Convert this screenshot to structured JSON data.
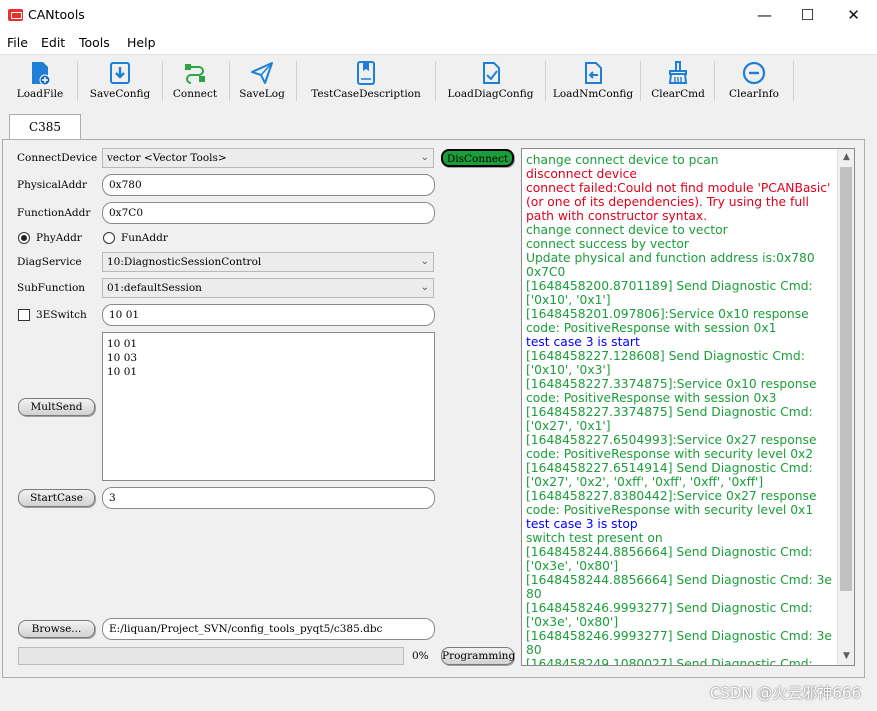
{
  "window": {
    "title": "CANtools",
    "minimize": "—",
    "maximize": "☐",
    "close": "✕"
  },
  "menu": {
    "items": [
      "File",
      "Edit",
      "Tools",
      "Help"
    ]
  },
  "toolbar": {
    "buttons": [
      {
        "label": "LoadFile",
        "icon": "file-load-icon"
      },
      {
        "label": "SaveConfig",
        "icon": "download-save-icon"
      },
      {
        "label": "Connect",
        "icon": "connect-icon"
      },
      {
        "label": "SaveLog",
        "icon": "paper-plane-icon"
      },
      {
        "label": "TestCaseDescription",
        "icon": "book-icon"
      },
      {
        "label": "LoadDiagConfig",
        "icon": "diag-config-icon"
      },
      {
        "label": "LoadNmConfig",
        "icon": "nm-config-icon"
      },
      {
        "label": "ClearCmd",
        "icon": "broom-icon"
      },
      {
        "label": "ClearInfo",
        "icon": "minus-circle-icon"
      }
    ]
  },
  "tab": {
    "label": "C385"
  },
  "form": {
    "connect_device_label": "ConnectDevice",
    "connect_device_value": "vector <Vector Tools>",
    "physical_addr_label": "PhysicalAddr",
    "physical_addr_value": "0x780",
    "function_addr_label": "FunctionAddr",
    "function_addr_value": "0x7C0",
    "phy_addr_label": "PhyAddr",
    "fun_addr_label": "FunAddr",
    "diag_service_label": "DiagService",
    "diag_service_value": "10:DiagnosticSessionControl",
    "sub_function_label": "SubFunction",
    "sub_function_value": "01:defaultSession",
    "switch_3e_label": "3ESwitch",
    "switch_3e_value": "10 01",
    "mult_send_lines": [
      "10 01",
      "10 03",
      "10 01"
    ],
    "mult_send_label": "MultSend",
    "start_case_label": "StartCase",
    "start_case_value": "3",
    "browse_label": "Browse...",
    "browse_path": "E:/liquan/Project_SVN/config_tools_pyqt5/c385.dbc",
    "progress_percent_text": "0%",
    "progress_value": 0,
    "programming_label": "Programming",
    "disconnect_label": "DisConnect"
  },
  "colors": {
    "green": "#1a9e3a",
    "red": "#e0001b",
    "blue": "#0000ff"
  },
  "log": {
    "lines": [
      {
        "text": "change connect device to pcan",
        "color": "green"
      },
      {
        "text": "disconnect device",
        "color": "red"
      },
      {
        "text": "connect failed:Could not find module 'PCANBasic' (or one of its dependencies). Try using the full path with constructor syntax.",
        "color": "red"
      },
      {
        "text": "change connect device to vector",
        "color": "green"
      },
      {
        "text": "connect success by vector",
        "color": "green"
      },
      {
        "text": "Update physical and function address is:0x780 0x7C0",
        "color": "green"
      },
      {
        "text": "[1648458200.8701189] Send Diagnostic Cmd: ['0x10', '0x1']",
        "color": "green"
      },
      {
        "text": "[1648458201.097806]:Service 0x10 response code: PositiveResponse with session 0x1",
        "color": "green"
      },
      {
        "text": "test case 3 is start",
        "color": "blue"
      },
      {
        "text": "[1648458227.128608] Send Diagnostic Cmd: ['0x10', '0x3']",
        "color": "green"
      },
      {
        "text": "[1648458227.3374875]:Service 0x10 response code: PositiveResponse with session 0x3",
        "color": "green"
      },
      {
        "text": "[1648458227.3374875] Send Diagnostic Cmd: ['0x27', '0x1']",
        "color": "green"
      },
      {
        "text": "[1648458227.6504993]:Service 0x27 response code: PositiveResponse with security level 0x2",
        "color": "green"
      },
      {
        "text": "[1648458227.6514914] Send Diagnostic Cmd: ['0x27', '0x2', '0xff', '0xff', '0xff', '0xff']",
        "color": "green"
      },
      {
        "text": "[1648458227.8380442]:Service 0x27 response code: PositiveResponse with security level 0x1",
        "color": "green"
      },
      {
        "text": "test case 3 is stop",
        "color": "blue"
      },
      {
        "text": "switch test present on",
        "color": "green"
      },
      {
        "text": "[1648458244.8856664] Send Diagnostic Cmd: ['0x3e', '0x80']",
        "color": "green"
      },
      {
        "text": "[1648458244.8856664] Send Diagnostic Cmd: 3e 80",
        "color": "green"
      },
      {
        "text": "[1648458246.9993277] Send Diagnostic Cmd: ['0x3e', '0x80']",
        "color": "green"
      },
      {
        "text": "[1648458246.9993277] Send Diagnostic Cmd: 3e 80",
        "color": "green"
      },
      {
        "text": "[1648458249.1080027] Send Diagnostic Cmd:",
        "color": "green"
      }
    ]
  },
  "watermark": "CSDN @火云邪神666"
}
